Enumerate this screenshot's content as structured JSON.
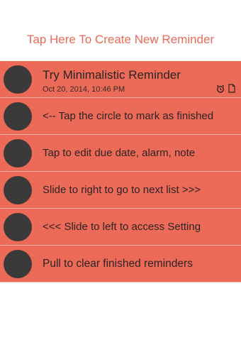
{
  "header": {
    "create_label": "Tap Here To Create New Reminder"
  },
  "reminders": [
    {
      "title": "Try Minimalistic Reminder",
      "date": "Oct 20, 2014, 10:46 PM",
      "icons": [
        "alarm-icon",
        "note-icon"
      ]
    },
    {
      "title": "<-- Tap the circle to mark as finished"
    },
    {
      "title": "Tap to edit due date, alarm, note"
    },
    {
      "title": "Slide to right to go to next list >>>"
    },
    {
      "title": "<<< Slide to left to access Setting"
    },
    {
      "title": "Pull to clear finished reminders"
    }
  ],
  "colors": {
    "accent": "#ee6a57",
    "row_background": "#ec6a58",
    "circle": "#3b3939",
    "text": "#2c2423"
  }
}
